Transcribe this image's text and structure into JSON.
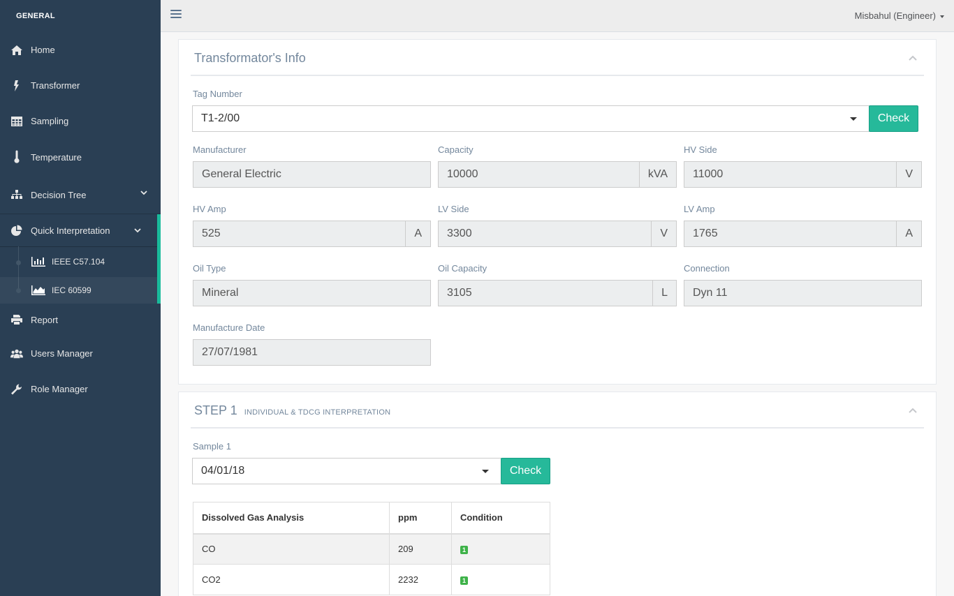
{
  "sidebar": {
    "section_title": "GENERAL",
    "items": [
      {
        "label": "Home",
        "icon": "home-icon"
      },
      {
        "label": "Transformer",
        "icon": "bolt-icon"
      },
      {
        "label": "Sampling",
        "icon": "table-icon"
      },
      {
        "label": "Temperature",
        "icon": "thermometer-icon"
      },
      {
        "label": "Decision Tree",
        "icon": "sitemap-icon"
      },
      {
        "label": "Quick Interpretation",
        "icon": "pie-chart-icon"
      },
      {
        "label": "Report",
        "icon": "print-icon"
      },
      {
        "label": "Users Manager",
        "icon": "users-icon"
      },
      {
        "label": "Role Manager",
        "icon": "wrench-icon"
      }
    ],
    "sub_items": [
      {
        "label": "IEEE C57.104",
        "icon": "bar-chart-icon"
      },
      {
        "label": "IEC 60599",
        "icon": "area-chart-icon"
      }
    ]
  },
  "topbar": {
    "user": "Misbahul (Engineer)"
  },
  "info_panel": {
    "title": "Transformator's Info",
    "tag_label": "Tag Number",
    "tag_value": "T1-2/00",
    "check_label": "Check",
    "fields": {
      "manufacturer": {
        "label": "Manufacturer",
        "value": "General Electric"
      },
      "capacity": {
        "label": "Capacity",
        "value": "10000",
        "unit": "kVA"
      },
      "hv_side": {
        "label": "HV Side",
        "value": "11000",
        "unit": "V"
      },
      "hv_amp": {
        "label": "HV Amp",
        "value": "525",
        "unit": "A"
      },
      "lv_side": {
        "label": "LV Side",
        "value": "3300",
        "unit": "V"
      },
      "lv_amp": {
        "label": "LV Amp",
        "value": "1765",
        "unit": "A"
      },
      "oil_type": {
        "label": "Oil Type",
        "value": "Mineral"
      },
      "oil_capacity": {
        "label": "Oil Capacity",
        "value": "3105",
        "unit": "L"
      },
      "connection": {
        "label": "Connection",
        "value": "Dyn 11"
      },
      "manufacture_date": {
        "label": "Manufacture Date",
        "value": "27/07/1981"
      }
    }
  },
  "step1": {
    "title": "STEP 1",
    "subtitle": "INDIVIDUAL & TDCG INTERPRETATION",
    "sample_label": "Sample 1",
    "sample_value": "04/01/18",
    "check_label": "Check",
    "table": {
      "headers": [
        "Dissolved Gas Analysis",
        "ppm",
        "Condition"
      ],
      "rows": [
        {
          "gas": "CO",
          "ppm": "209",
          "condition": "1"
        },
        {
          "gas": "CO2",
          "ppm": "2232",
          "condition": "1"
        }
      ]
    }
  }
}
